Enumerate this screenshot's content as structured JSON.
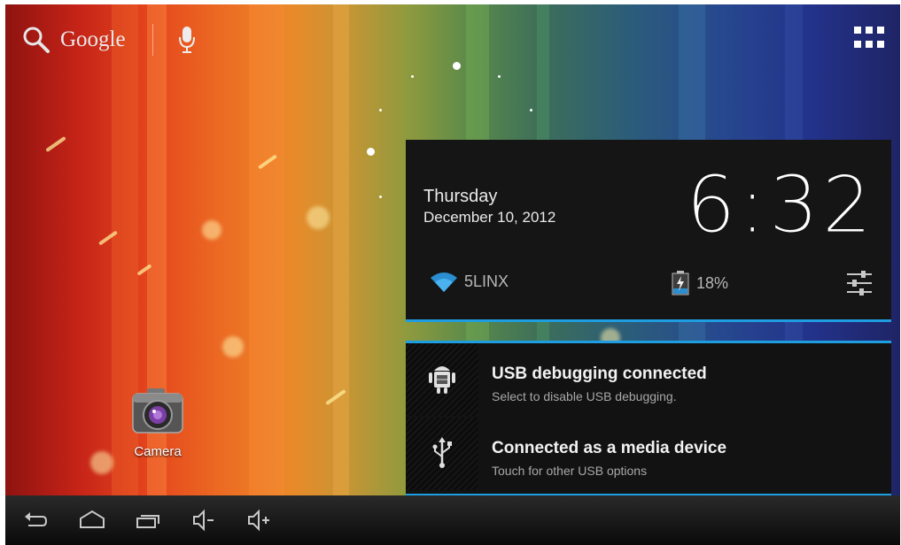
{
  "search": {
    "label": "Google",
    "icon": "search-icon",
    "voice_icon": "microphone-icon"
  },
  "launcher": {
    "apps_icon": "app-grid-icon"
  },
  "clock_widget": {
    "day": "Thursday",
    "date": "December 10, 2012",
    "time": "6:32",
    "wifi_name": "5LINX",
    "battery": "18%",
    "settings_icon": "settings-sliders-icon"
  },
  "notifications": [
    {
      "title": "USB debugging connected",
      "subtitle": "Select to disable USB debugging.",
      "icon": "android-debug-icon"
    },
    {
      "title": "Connected as a media device",
      "subtitle": "Touch for other USB options",
      "icon": "usb-icon"
    }
  ],
  "desktop": {
    "camera_label": "Camera"
  },
  "navbar": {
    "icons": [
      "back-icon",
      "home-icon",
      "recent-apps-icon",
      "volume-down-icon",
      "volume-up-icon"
    ]
  },
  "colors": {
    "accent": "#1e9de0",
    "panel": "#151515"
  }
}
